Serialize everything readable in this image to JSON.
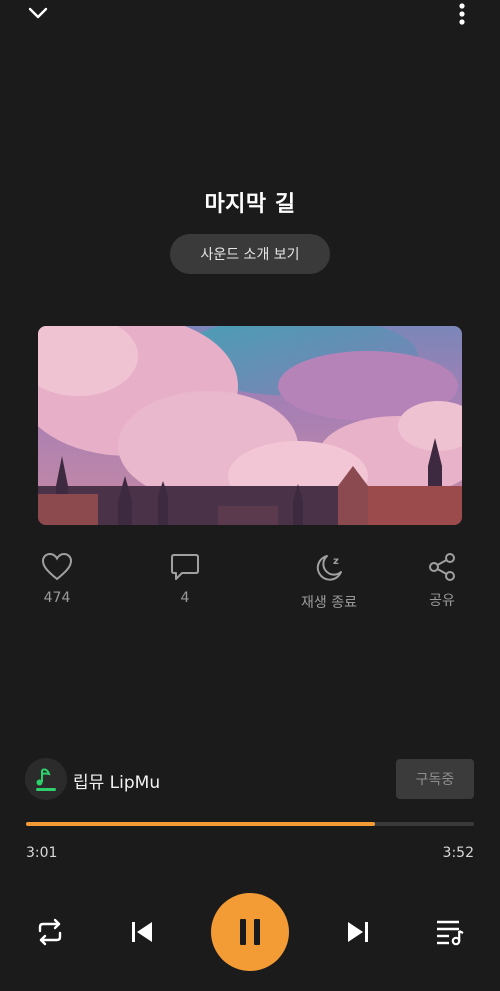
{
  "header": {
    "collapse_icon": "chevron-down-icon",
    "menu_icon": "more-vertical-icon"
  },
  "track": {
    "title": "마지막 길",
    "intro_button_label": "사운드 소개 보기",
    "artwork": "pink-clouds-castle-skyline-artwork"
  },
  "actions": {
    "like": {
      "icon": "heart-icon",
      "label": "474"
    },
    "comment": {
      "icon": "comment-icon",
      "label": "4"
    },
    "sleep_timer": {
      "icon": "moon-z-icon",
      "label": "재생 종료"
    },
    "share": {
      "icon": "share-icon",
      "label": "공유"
    }
  },
  "channel": {
    "name": "립뮤 LipMu",
    "subscribe_label": "구독중"
  },
  "playback": {
    "current_time": "3:01",
    "total_time": "3:52",
    "progress_fraction": 0.78,
    "state": "playing"
  },
  "controls": {
    "repeat_icon": "repeat-icon",
    "prev_icon": "skip-previous-icon",
    "pause_icon": "pause-icon",
    "next_icon": "skip-next-icon",
    "queue_icon": "playlist-icon"
  },
  "colors": {
    "background": "#1b1b1b",
    "accent": "#f39c36"
  }
}
